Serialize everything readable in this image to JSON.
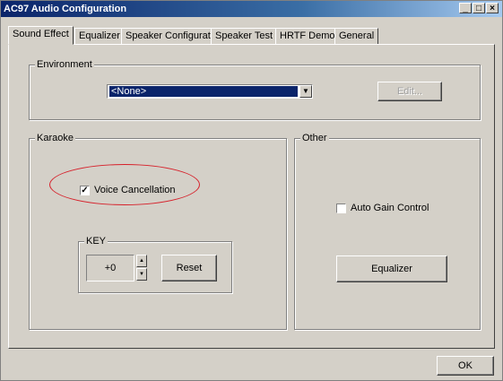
{
  "window": {
    "title": "AC97 Audio Configuration",
    "buttons": {
      "minimize": "_",
      "maximize": "□",
      "close": "×"
    }
  },
  "tabs": [
    {
      "label": "Sound Effect",
      "active": true
    },
    {
      "label": "Equalizer"
    },
    {
      "label": "Speaker Configuration"
    },
    {
      "label": "Speaker Test"
    },
    {
      "label": "HRTF Demo"
    },
    {
      "label": "General"
    }
  ],
  "environment": {
    "group_label": "Environment",
    "selected": "<None>",
    "edit_label": "Edit..."
  },
  "karaoke": {
    "group_label": "Karaoke",
    "voice_cancellation": {
      "label": "Voice Cancellation",
      "checked": true,
      "mark": "✓"
    },
    "key": {
      "group_label": "KEY",
      "value": "+0",
      "reset_label": "Reset"
    }
  },
  "other": {
    "group_label": "Other",
    "auto_gain": {
      "label": "Auto Gain Control",
      "checked": false
    },
    "equalizer_label": "Equalizer"
  },
  "footer": {
    "ok_label": "OK"
  },
  "colors": {
    "annotation_circle": "#d6202a",
    "title_bar": "#0a246a"
  }
}
